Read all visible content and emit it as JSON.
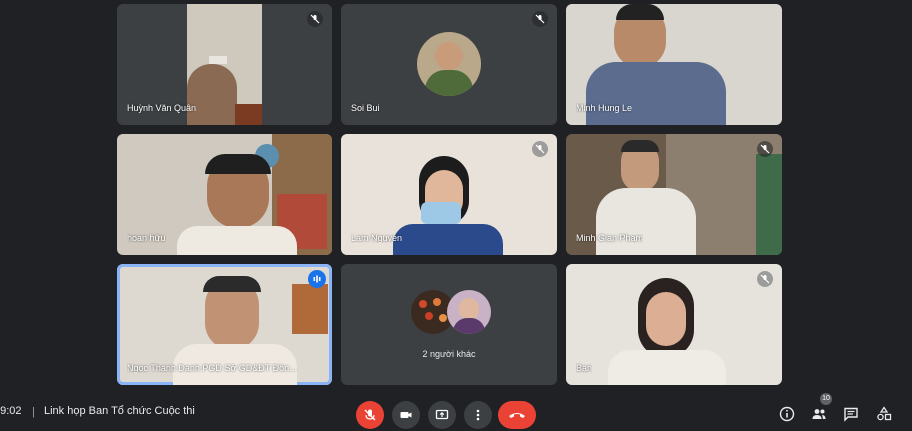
{
  "tiles": {
    "huynh": {
      "name": "Huỳnh Văn Quân"
    },
    "soi": {
      "name": "Soi Bui"
    },
    "minhhung": {
      "name": "Minh Hung Le"
    },
    "hoan": {
      "name": "hoan hữu"
    },
    "lam": {
      "name": "Lam Nguyen"
    },
    "minhgian": {
      "name": "Minh Gian Pham"
    },
    "ngoc": {
      "name": "Ngọc Thanh Danh PGD Sở GD&ĐT Đồn..."
    },
    "others": {
      "label": "2 người khác"
    },
    "ban": {
      "name": "Bạn"
    }
  },
  "meeting": {
    "time": "09:02",
    "title": "Link họp Ban Tổ chức Cuộc thi"
  },
  "participants_count": "10",
  "colors": {
    "background": "#202124",
    "tile": "#3c4043",
    "accent": "#8ab4f8",
    "danger": "#ea4335"
  },
  "icons": [
    "mic-off-icon",
    "camera-icon",
    "present-icon",
    "more-icon",
    "hang-up-icon",
    "info-icon",
    "people-icon",
    "chat-icon",
    "activities-icon"
  ]
}
